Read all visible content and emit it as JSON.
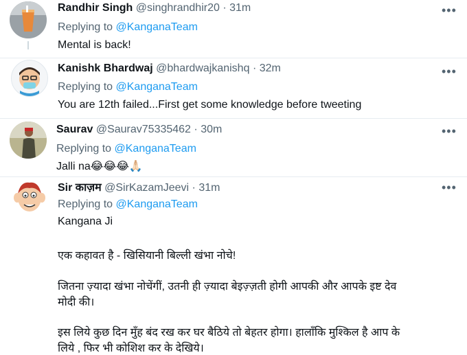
{
  "tweets": [
    {
      "name": "Randhir Singh",
      "handle": "@singhrandhir20",
      "dot": "·",
      "time": "31m",
      "replying_prefix": "Replying to",
      "replying_to": "@KanganaTeam",
      "text": "Mental is back!",
      "more": "•••"
    },
    {
      "name": "Kanishk Bhardwaj",
      "handle": "@bhardwajkanishq",
      "dot": "·",
      "time": "32m",
      "replying_prefix": "Replying to",
      "replying_to": "@KanganaTeam",
      "text": "You are 12th failed...First get some knowledge before tweeting",
      "more": "•••"
    },
    {
      "name": "Saurav",
      "handle": "@Saurav75335462",
      "dot": "·",
      "time": "30m",
      "replying_prefix": "Replying to",
      "replying_to": "@KanganaTeam",
      "text": "Jalli na😂😂😂🙏🏻",
      "more": "•••"
    },
    {
      "name": "Sir काज़म",
      "handle": "@SirKazamJeevi",
      "dot": "·",
      "time": "31m",
      "replying_prefix": "Replying to",
      "replying_to": "@KanganaTeam",
      "lines": [
        "Kangana Ji",
        "एक कहावत है - खिसियानी बिल्ली खंभा नोचे!",
        "जितना ज़्यादा खंभा नोचेंगीं, उतनी ही ज़्यादा बेइज़्ज़ती होगी आपकी और आपके इष्ट देव",
        "मोदी की।",
        "इस लिये कुछ दिन मुँह बंद रख कर घर बैठिये तो बेहतर होगा। हालाँकि मुश्किल है आप के",
        "लिये , फिर भी कोशिश कर के देखिये।"
      ],
      "more": "•••"
    }
  ]
}
